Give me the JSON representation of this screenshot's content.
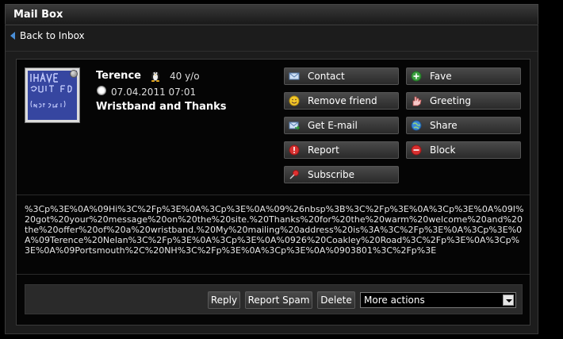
{
  "window": {
    "title": "Mail Box"
  },
  "nav": {
    "back_label": "Back to Inbox"
  },
  "message": {
    "sender": "Terence",
    "age": "40 y/o",
    "date": "07.04.2011 07:01",
    "subject": "Wristband and Thanks",
    "avatar_text": "I HAVE QUIT FB (NOT PEPSI)",
    "body": "%3Cp%3E%0A%09Hi%3C%2Fp%3E%0A%3Cp%3E%0A%09%26nbsp%3B%3C%2Fp%3E%0A%3Cp%3E%0A%09I%20got%20your%20message%20on%20the%20site.%20Thanks%20for%20the%20warm%20welcome%20and%20the%20offer%20of%20a%20wristband.%20My%20mailing%20address%20is%3A%3C%2Fp%3E%0A%3Cp%3E%0A%09Terence%20Nelan%3C%2Fp%3E%0A%3Cp%3E%0A%0926%20Coakley%20Road%3C%2Fp%3E%0A%3Cp%3E%0A%09Portsmouth%2C%20NH%3C%2Fp%3E%0A%3Cp%3E%0A%0903801%3C%2Fp%3E"
  },
  "profile_actions": {
    "contact": "Contact",
    "fave": "Fave",
    "remove_friend": "Remove friend",
    "greeting": "Greeting",
    "get_email": "Get E-mail",
    "share": "Share",
    "report": "Report",
    "block": "Block",
    "subscribe": "Subscribe"
  },
  "message_actions": {
    "reply": "Reply",
    "report_spam": "Report Spam",
    "delete": "Delete",
    "more_actions": "More actions"
  },
  "colors": {
    "background": "#000000",
    "panel": "#1c1c1c",
    "accent": "#4a8fd8"
  }
}
